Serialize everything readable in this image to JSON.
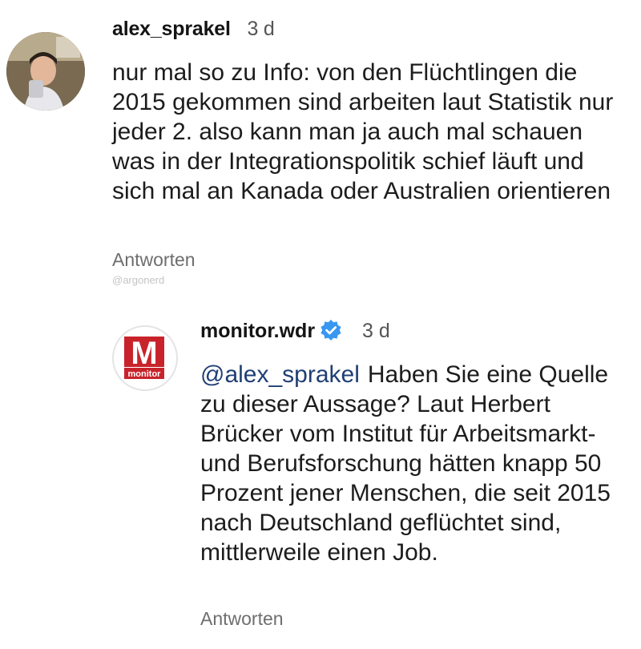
{
  "comment": {
    "username": "alex_sprakel",
    "time": "3 d",
    "text": "nur mal so zu Info: von den Flüchtlingen die 2015 gekommen sind arbeiten laut Statistik nur jeder 2. also kann man ja auch mal schauen was in der Integrationspolitik schief läuft und sich mal an Kanada oder Australien orientieren",
    "reply_label": "Antworten"
  },
  "watermark": "@argonerd",
  "reply": {
    "username": "monitor.wdr",
    "time": "3 d",
    "mention": "@alex_sprakel",
    "text": "Haben Sie eine Quelle zu dieser Aussage? Laut Herbert Brücker vom Institut für Arbeitsmarkt- und Berufsforschung hätten knapp 50 Prozent jener Menschen, die seit 2015 nach Deutschland geflüchtet sind, mittlerweile einen Job.",
    "reply_label": "Antworten",
    "brand_logo_text": "monitor",
    "brand_logo_letter": "M"
  },
  "colors": {
    "mention": "#1f3f74",
    "verified": "#3897f0",
    "brand_red": "#c8232b",
    "muted_text": "#6e6e6e"
  }
}
